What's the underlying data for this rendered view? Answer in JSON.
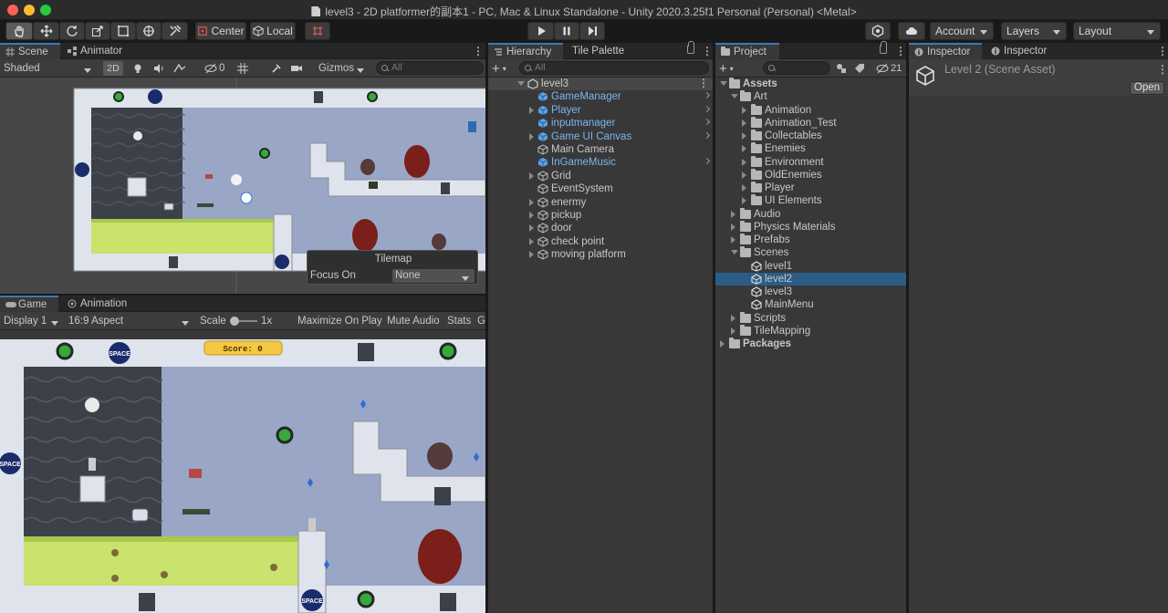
{
  "window": {
    "title": "level3 - 2D platformer的副本1 - PC, Mac & Linux Standalone - Unity 2020.3.25f1 Personal (Personal) <Metal>"
  },
  "toolbar": {
    "center_label": "Center",
    "local_label": "Local",
    "account_label": "Account",
    "layers_label": "Layers",
    "layout_label": "Layout"
  },
  "scene_view": {
    "tab_scene": "Scene",
    "tab_animator": "Animator",
    "shading_mode": "Shaded",
    "mode_2d": "2D",
    "hidden_count": "0",
    "gizmos_label": "Gizmos",
    "search_placeholder": "All",
    "score_text": "Score: 0",
    "tilemap_overlay": {
      "title": "Tilemap",
      "focus_label": "Focus On",
      "focus_value": "None"
    },
    "sign_text": "SPACE"
  },
  "game_view": {
    "tab_game": "Game",
    "tab_animation": "Animation",
    "display": "Display 1",
    "aspect": "16:9 Aspect",
    "scale_label": "Scale",
    "scale_value": "1x",
    "maximize_label": "Maximize On Play",
    "mute_label": "Mute Audio",
    "stats_label": "Stats",
    "gizmos_partial": "Gi"
  },
  "hierarchy": {
    "tab_hierarchy": "Hierarchy",
    "tab_tile_palette": "Tile Palette",
    "search_placeholder": "All",
    "scene_name": "level3",
    "items": [
      {
        "label": "GameManager",
        "prefab": true,
        "expandable": false
      },
      {
        "label": "Player",
        "prefab": true,
        "expandable": true
      },
      {
        "label": "inputmanager",
        "prefab": true,
        "expandable": false
      },
      {
        "label": "Game UI Canvas",
        "prefab": true,
        "expandable": true
      },
      {
        "label": "Main Camera",
        "prefab": false,
        "expandable": false
      },
      {
        "label": "InGameMusic",
        "prefab": true,
        "expandable": false
      },
      {
        "label": "Grid",
        "prefab": false,
        "expandable": true
      },
      {
        "label": "EventSystem",
        "prefab": false,
        "expandable": false
      },
      {
        "label": "enermy",
        "prefab": false,
        "expandable": true
      },
      {
        "label": "pickup",
        "prefab": false,
        "expandable": true
      },
      {
        "label": "door",
        "prefab": false,
        "expandable": true
      },
      {
        "label": "check point",
        "prefab": false,
        "expandable": true
      },
      {
        "label": "moving platform",
        "prefab": false,
        "expandable": true
      }
    ]
  },
  "project": {
    "tab_project": "Project",
    "hidden_count": "21",
    "tree": [
      {
        "label": "Assets",
        "depth": 0,
        "type": "folder",
        "state": "open",
        "bold": true
      },
      {
        "label": "Art",
        "depth": 1,
        "type": "folder",
        "state": "open"
      },
      {
        "label": "Animation",
        "depth": 2,
        "type": "folder",
        "state": "closed"
      },
      {
        "label": "Animation_Test",
        "depth": 2,
        "type": "folder",
        "state": "closed"
      },
      {
        "label": "Collectables",
        "depth": 2,
        "type": "folder",
        "state": "closed"
      },
      {
        "label": "Enemies",
        "depth": 2,
        "type": "folder",
        "state": "closed"
      },
      {
        "label": "Environment",
        "depth": 2,
        "type": "folder",
        "state": "closed"
      },
      {
        "label": "OldEnemies",
        "depth": 2,
        "type": "folder",
        "state": "closed"
      },
      {
        "label": "Player",
        "depth": 2,
        "type": "folder",
        "state": "closed"
      },
      {
        "label": "UI Elements",
        "depth": 2,
        "type": "folder",
        "state": "closed"
      },
      {
        "label": "Audio",
        "depth": 1,
        "type": "folder",
        "state": "closed"
      },
      {
        "label": "Physics Materials",
        "depth": 1,
        "type": "folder",
        "state": "closed"
      },
      {
        "label": "Prefabs",
        "depth": 1,
        "type": "folder",
        "state": "closed"
      },
      {
        "label": "Scenes",
        "depth": 1,
        "type": "folder",
        "state": "open"
      },
      {
        "label": "level1",
        "depth": 2,
        "type": "scene",
        "state": "none"
      },
      {
        "label": "level2",
        "depth": 2,
        "type": "scene",
        "state": "none",
        "selected": true
      },
      {
        "label": "level3",
        "depth": 2,
        "type": "scene",
        "state": "none"
      },
      {
        "label": "MainMenu",
        "depth": 2,
        "type": "scene",
        "state": "none"
      },
      {
        "label": "Scripts",
        "depth": 1,
        "type": "folder",
        "state": "closed"
      },
      {
        "label": "TileMapping",
        "depth": 1,
        "type": "folder",
        "state": "closed"
      },
      {
        "label": "Packages",
        "depth": 0,
        "type": "folder",
        "state": "closed",
        "bold": true
      }
    ]
  },
  "inspector": {
    "tab1": "Inspector",
    "tab2": "Inspector",
    "asset_title": "Level 2 (Scene Asset)",
    "open_label": "Open"
  },
  "colors": {
    "accent": "#3a79bb",
    "selection": "#2c5d87",
    "prefab_text": "#7cb4f0",
    "grass": "#c9e36d",
    "wall_dark": "#3c4149",
    "sky": "#9aa6c6"
  }
}
